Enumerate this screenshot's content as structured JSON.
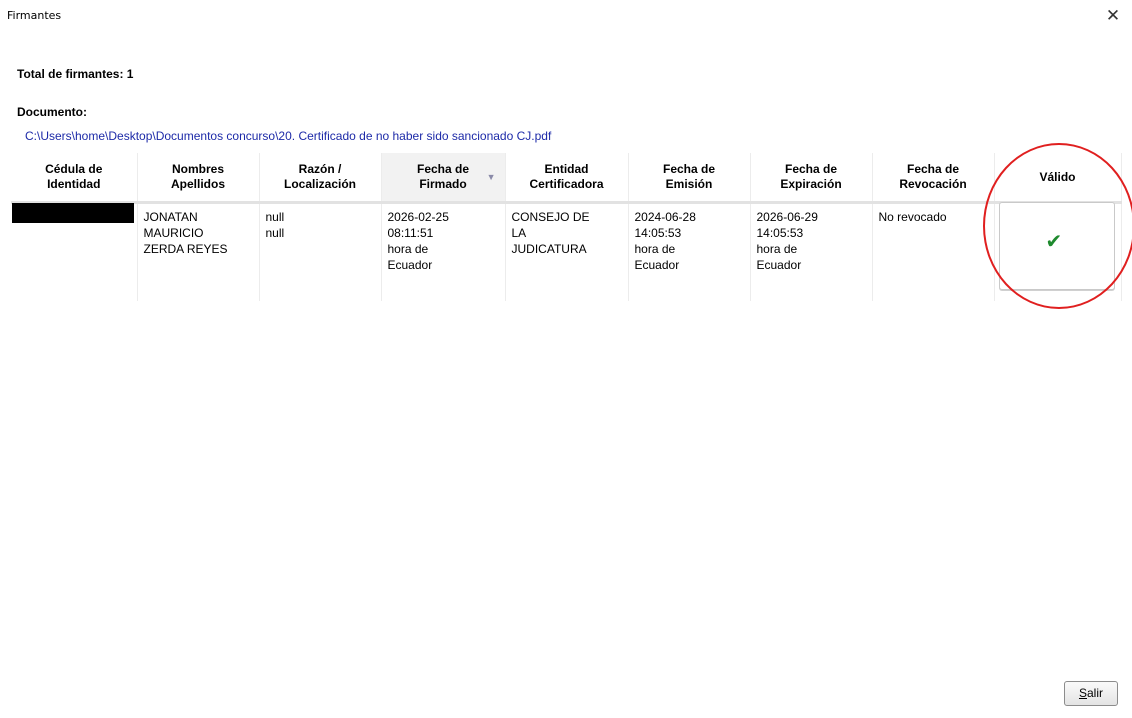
{
  "window": {
    "title": "Firmantes",
    "close_symbol": "✕"
  },
  "summary": {
    "total_label": "Total de firmantes: 1",
    "document_label": "Documento:",
    "document_path": "C:\\Users\\home\\Desktop\\Documentos concurso\\20. Certificado de no haber sido sancionado CJ.pdf"
  },
  "table": {
    "columns": [
      {
        "line1": "Cédula de",
        "line2": "Identidad"
      },
      {
        "line1": "Nombres",
        "line2": "Apellidos"
      },
      {
        "line1": "Razón /",
        "line2": "Localización"
      },
      {
        "line1": "Fecha de",
        "line2": "Firmado"
      },
      {
        "line1": "Entidad",
        "line2": "Certificadora"
      },
      {
        "line1": "Fecha de",
        "line2": "Emisión"
      },
      {
        "line1": "Fecha de",
        "line2": "Expiración"
      },
      {
        "line1": "Fecha de",
        "line2": "Revocación"
      },
      {
        "line1": "Válido",
        "line2": ""
      }
    ],
    "sort_indicator": "▼",
    "rows": [
      {
        "nombres": [
          "JONATAN",
          "MAURICIO",
          "ZERDA REYES"
        ],
        "razon": [
          "null",
          "null"
        ],
        "fecha_firmado": [
          "2026-02-25",
          "08:11:51",
          "hora de",
          "Ecuador"
        ],
        "entidad": [
          "CONSEJO DE",
          "LA",
          "JUDICATURA"
        ],
        "fecha_emision": [
          "2024-06-28",
          "14:05:53",
          "hora de",
          "Ecuador"
        ],
        "fecha_expiracion": [
          "2026-06-29",
          "14:05:53",
          "hora de",
          "Ecuador"
        ],
        "fecha_revocacion": "No revocado",
        "valido_icon": "checkmark-icon",
        "valido_symbol": "✔"
      }
    ]
  },
  "footer": {
    "exit_mnemonic": "S",
    "exit_rest": "alir"
  },
  "colors": {
    "path_link": "#1d2aa8",
    "check_green": "#1e8a2e",
    "annotation_red": "#e01f1f"
  }
}
